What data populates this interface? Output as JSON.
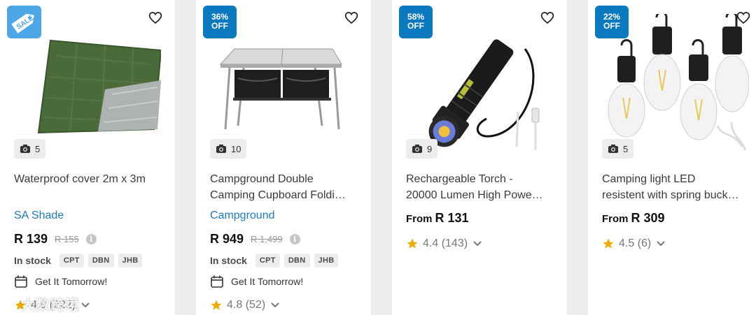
{
  "products": [
    {
      "badge": "SALE",
      "photo_count": "5",
      "title_lines": [
        "Waterproof cover 2m x 3m"
      ],
      "brand": "SA Shade",
      "price": "R 139",
      "list_price": "R 155",
      "stock_label": "In stock",
      "warehouses": [
        "CPT",
        "DBN",
        "JHB"
      ],
      "delivery": "Get It Tomorrow!",
      "rating": "4.8 (222)"
    },
    {
      "badge_line1": "36%",
      "badge_line2": "OFF",
      "photo_count": "10",
      "title_lines": [
        "Campground Double",
        "Camping Cupboard Foldi…"
      ],
      "brand": "Campground",
      "price": "R 949",
      "list_price": "R 1,499",
      "stock_label": "In stock",
      "warehouses": [
        "CPT",
        "DBN",
        "JHB"
      ],
      "delivery": "Get It Tomorrow!",
      "rating": "4.8 (52)"
    },
    {
      "badge_line1": "58%",
      "badge_line2": "OFF",
      "photo_count": "9",
      "title_lines": [
        "Rechargeable Torch -",
        "20000 Lumen High Powe…"
      ],
      "from_label": "From",
      "price": "R 131",
      "rating": "4.4 (143)"
    },
    {
      "badge_line1": "22%",
      "badge_line2": "OFF",
      "photo_count": "5",
      "title_lines": [
        "Camping light LED",
        "resistent with spring buck…"
      ],
      "from_label": "From",
      "price": "R 309",
      "rating": "4.5 (6)"
    }
  ],
  "watermark": "大数跨境",
  "colors": {
    "badge_blue": "#0b79bf",
    "brand_link": "#1f7bc0",
    "star": "#f2a900"
  }
}
